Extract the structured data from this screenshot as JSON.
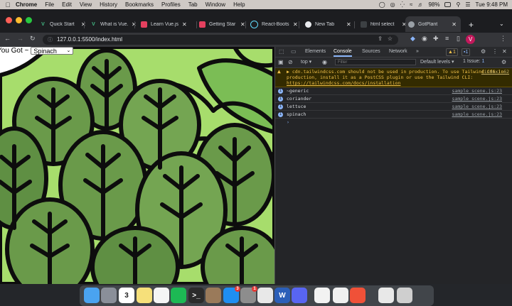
{
  "menubar": {
    "app_name": "Chrome",
    "items": [
      "File",
      "Edit",
      "View",
      "History",
      "Bookmarks",
      "Profiles",
      "Tab",
      "Window",
      "Help"
    ],
    "battery": "98%",
    "clock": "Tue 9:48 PM"
  },
  "tabs": [
    {
      "title": "Quick Start",
      "favicon": "vue-icon"
    },
    {
      "title": "What is Vue.",
      "favicon": "vue-icon"
    },
    {
      "title": "Learn Vue.js",
      "favicon": "bookmark-icon"
    },
    {
      "title": "Getting Star",
      "favicon": "bookmark-icon"
    },
    {
      "title": "React-Boots",
      "favicon": "react-icon"
    },
    {
      "title": "New Tab",
      "favicon": "chrome-icon"
    },
    {
      "title": "html select",
      "favicon": "document-icon"
    },
    {
      "title": "GotPlant",
      "favicon": "globe-icon"
    }
  ],
  "address_bar": {
    "url": "127.0.0.1:5500/index.html",
    "profile_initial": "V"
  },
  "page": {
    "label": "You Got ~",
    "select_value": "Spinach",
    "bg_colors": {
      "leaf_dark": "#6a9a4a",
      "leaf_light": "#90c66a",
      "bright": "#a7dd6c",
      "outline": "#0d0d0d"
    }
  },
  "devtools": {
    "tabs": [
      "Elements",
      "Console",
      "Sources",
      "Network"
    ],
    "active_tab": "Console",
    "more": "»",
    "warning_count": "1",
    "info_count": "1",
    "context": "top",
    "filter_placeholder": "Filter",
    "levels": "Default levels",
    "issues": "1 Issue:",
    "issues_count": "1",
    "warning": {
      "text": "▶ cdn.tailwindcss.com should not be used in production. To use Tailwind CSS in production, install it as a PostCSS plugin or use the Tailwind CLI: ",
      "link": "https://tailwindcss.com/docs/installation",
      "source": "(index):62"
    },
    "logs": [
      {
        "count": "1",
        "text": "~generic",
        "source": "sample_scene.js:23"
      },
      {
        "count": "1",
        "text": "coriander",
        "source": "sample_scene.js:23"
      },
      {
        "count": "1",
        "text": "lettuce",
        "source": "sample_scene.js:23"
      },
      {
        "count": "1",
        "text": "spinach",
        "source": "sample_scene.js:23"
      }
    ],
    "prompt": "›"
  },
  "dock": {
    "apps": [
      {
        "name": "Finder",
        "icon": "finder-icon",
        "color": "#4aa3f0"
      },
      {
        "name": "Launchpad",
        "icon": "rocket-icon",
        "color": "#8a8f99"
      },
      {
        "name": "Calendar",
        "icon": "calendar-icon",
        "color": "#ffffff",
        "text": "3"
      },
      {
        "name": "Notes",
        "icon": "notes-icon",
        "color": "#f6e07a"
      },
      {
        "name": "Reminders",
        "icon": "reminders-icon",
        "color": "#f5f5f5"
      },
      {
        "name": "Spotify",
        "icon": "spotify-icon",
        "color": "#1db954"
      },
      {
        "name": "Terminal",
        "icon": "terminal-icon",
        "color": "#2b2b2b",
        "text": ">_"
      },
      {
        "name": "Books",
        "icon": "books-icon",
        "color": "#9a7a5a"
      },
      {
        "name": "App Store",
        "icon": "app-store-icon",
        "color": "#1f8ef1",
        "badge": "3"
      },
      {
        "name": "System Preferences",
        "icon": "gear-icon",
        "color": "#8d8d8d",
        "badge": "1"
      },
      {
        "name": "Chrome",
        "icon": "chrome-icon",
        "color": "#e8e8e8"
      },
      {
        "name": "Word",
        "icon": "word-icon",
        "color": "#2b5fb8",
        "text": "W"
      },
      {
        "name": "Discord",
        "icon": "discord-icon",
        "color": "#5865f2"
      },
      {
        "name": "VS Code",
        "icon": "vscode-icon",
        "color": "#f2f2f2"
      },
      {
        "name": "MongoDB Compass",
        "icon": "mongodb-icon",
        "color": "#f0f0f0"
      },
      {
        "name": "Swift Playgrounds",
        "icon": "swift-icon",
        "color": "#f05138"
      },
      {
        "name": "Document",
        "icon": "document-icon",
        "color": "#e8e8e8"
      },
      {
        "name": "Trash",
        "icon": "trash-icon",
        "color": "#cfcfcf"
      }
    ]
  }
}
